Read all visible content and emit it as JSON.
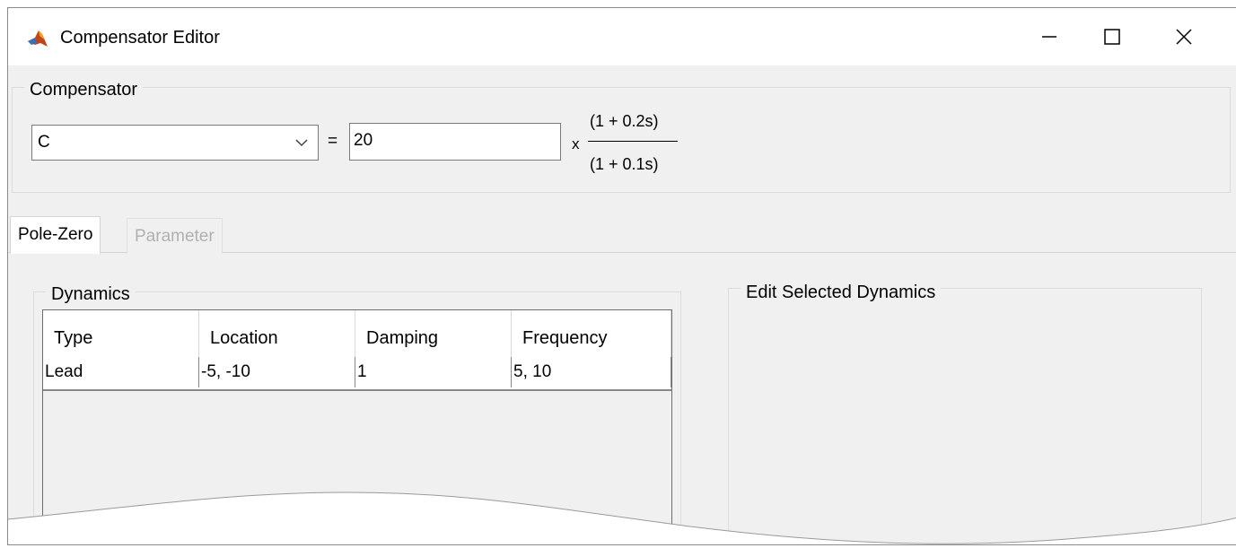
{
  "window": {
    "title": "Compensator Editor",
    "controls": {
      "minimize": "minimize-icon",
      "maximize": "maximize-icon",
      "close": "close-icon"
    }
  },
  "compensator": {
    "group_label": "Compensator",
    "selected": "C",
    "equals": "=",
    "gain": "20",
    "times": "x",
    "numerator": "(1 + 0.2s)",
    "denominator": "(1 + 0.1s)"
  },
  "tabs": [
    {
      "label": "Pole-Zero",
      "active": true
    },
    {
      "label": "Parameter",
      "active": false
    }
  ],
  "dynamics": {
    "group_label": "Dynamics",
    "columns": [
      "Type",
      "Location",
      "Damping",
      "Frequency"
    ],
    "rows": [
      [
        "Lead",
        "-5, -10",
        "1",
        "5, 10"
      ]
    ]
  },
  "edit_selected": {
    "group_label": "Edit Selected Dynamics"
  },
  "colors": {
    "window_bg": "#f0f0f0",
    "titlebar_bg": "#ffffff",
    "disabled_text": "#b0b0b0"
  }
}
